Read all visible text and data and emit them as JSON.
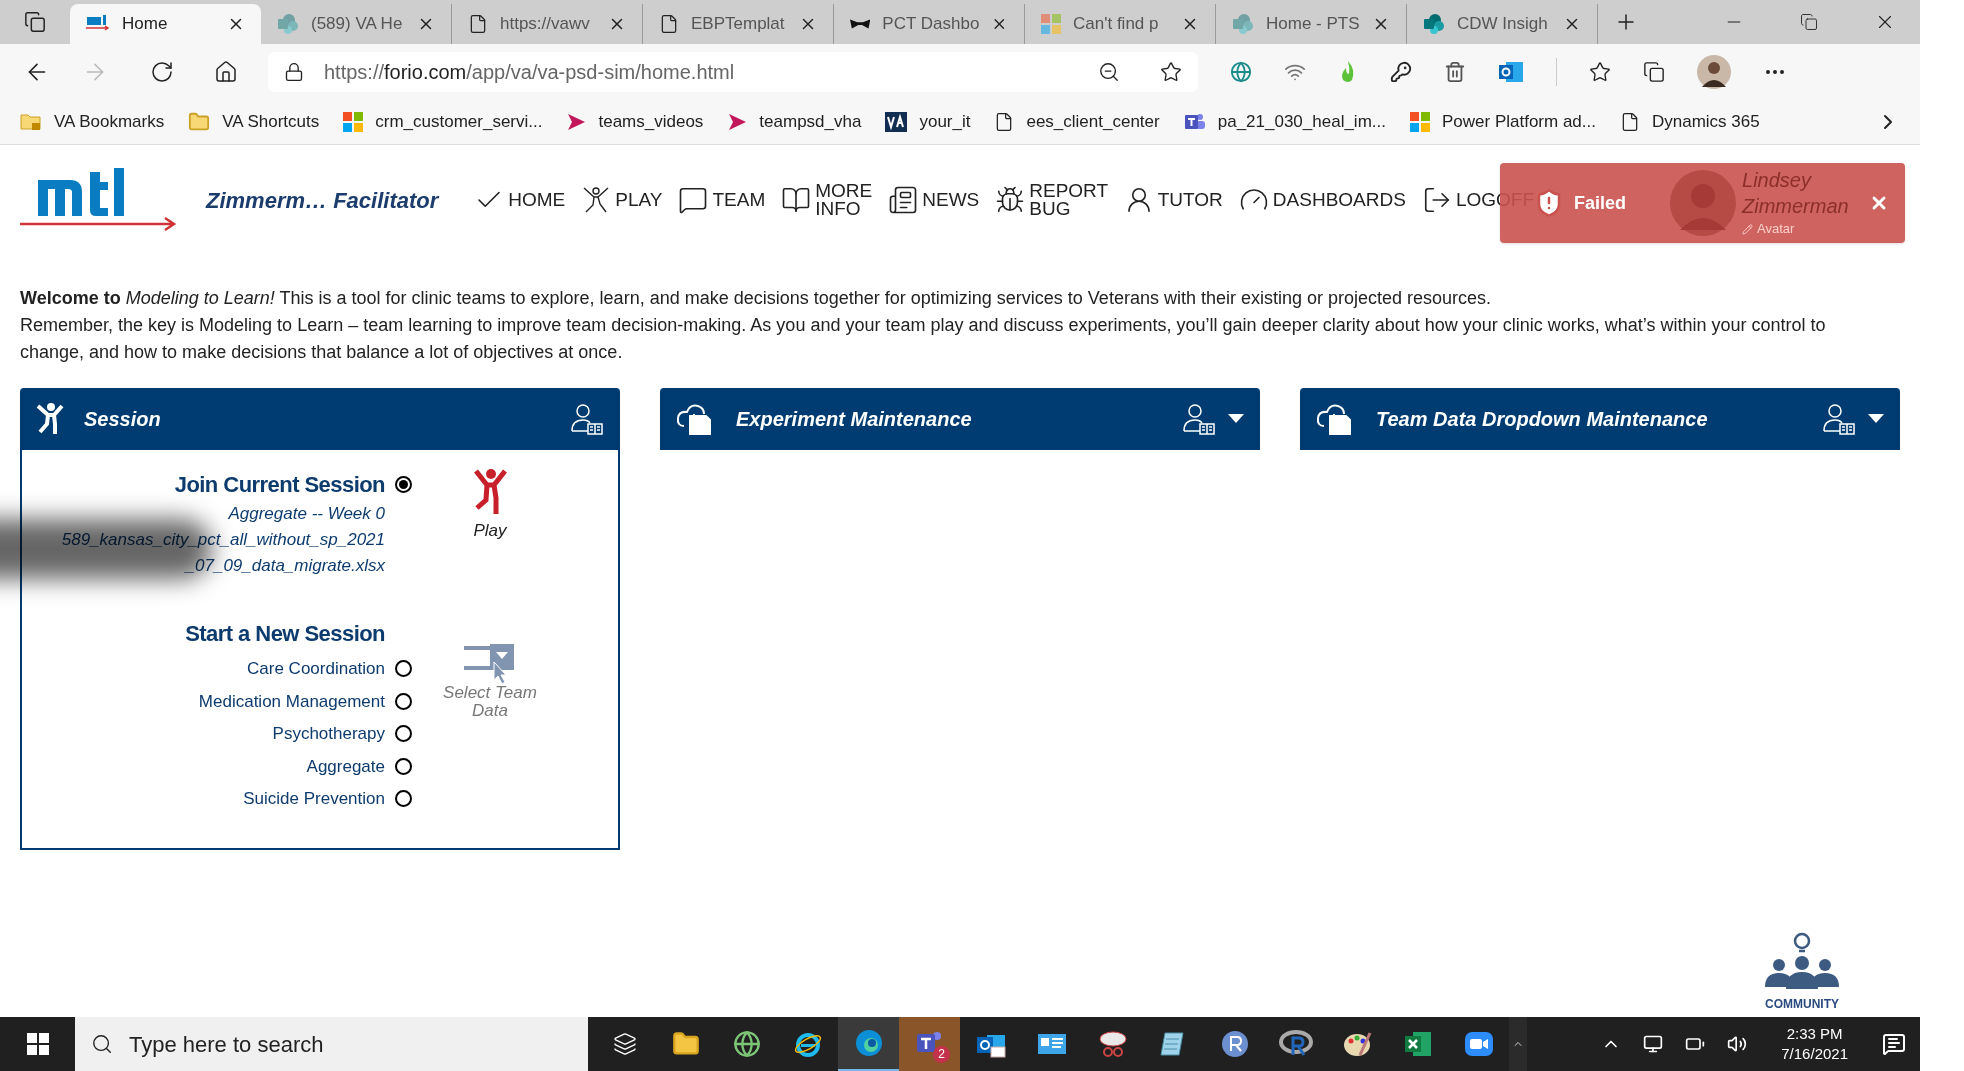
{
  "browser": {
    "tabs": [
      {
        "label": "Home",
        "kind": "mtl",
        "selected": true
      },
      {
        "label": "(589) VA He",
        "kind": "sharepoint-faded",
        "selected": false
      },
      {
        "label": "https://vawv",
        "kind": "page",
        "selected": false
      },
      {
        "label": "EBPTemplat",
        "kind": "page",
        "selected": false
      },
      {
        "label": "PCT Dashbo",
        "kind": "mask",
        "selected": false
      },
      {
        "label": "Can't find p",
        "kind": "windows-faded",
        "selected": false
      },
      {
        "label": "Home - PTS",
        "kind": "sharepoint-faded",
        "selected": false
      },
      {
        "label": "CDW Insigh",
        "kind": "sharepoint",
        "selected": false
      }
    ],
    "address": {
      "scheme": "https://",
      "host": "forio.com",
      "path": "/app/va/va-psd-sim/home.html"
    },
    "bookmarks": [
      {
        "label": "VA Bookmarks",
        "kind": "folder-lock"
      },
      {
        "label": "VA Shortcuts",
        "kind": "folder"
      },
      {
        "label": "crm_customer_servi...",
        "kind": "windows"
      },
      {
        "label": "teams_videos",
        "kind": "play"
      },
      {
        "label": "teampsd_vha",
        "kind": "play"
      },
      {
        "label": "your_it",
        "kind": "va"
      },
      {
        "label": "ees_client_center",
        "kind": "page"
      },
      {
        "label": "pa_21_030_heal_im...",
        "kind": "teams"
      },
      {
        "label": "Power Platform ad...",
        "kind": "windows"
      },
      {
        "label": "Dynamics 365",
        "kind": "page"
      }
    ]
  },
  "app": {
    "title": "Zimmerm… Facilitator",
    "nav": [
      {
        "label": "HOME",
        "kind": "check"
      },
      {
        "label": "PLAY",
        "kind": "play"
      },
      {
        "label": "TEAM",
        "kind": "chat"
      },
      {
        "label": "MORE INFO",
        "kind": "book"
      },
      {
        "label": "NEWS",
        "kind": "news"
      },
      {
        "label": "REPORT BUG",
        "kind": "bug"
      },
      {
        "label": "TUTOR",
        "kind": "tutor"
      },
      {
        "label": "DASHBOARDS",
        "kind": "gauge"
      },
      {
        "label": "LOGOFF",
        "kind": "logoff"
      }
    ],
    "toast": {
      "status": "Failed",
      "user": "Lindsey Zimmerman",
      "avatar_link": "Avatar"
    },
    "welcome": [
      "**Welcome to** *Modeling to Learn!* This is a tool for clinic teams to explore, learn, and make decisions together for optimizing services to Veterans with their existing or projected resources.",
      "Remember, the key is Modeling to Learn – team learning to improve team decision-making. As you and your team play and discuss experiments, you’ll gain deeper clarity about how your clinic works, what’s within your control to change, and how to make decisions that balance a lot of objectives at once."
    ],
    "panels": [
      {
        "title": "Session",
        "kind": "session",
        "dropdown": false
      },
      {
        "title": "Experiment Maintenance",
        "kind": "maintenance",
        "dropdown": true
      },
      {
        "title": "Team Data Dropdown Maintenance",
        "kind": "maintenance",
        "dropdown": true
      }
    ],
    "session": {
      "join": {
        "heading": "Join Current Session",
        "selected": true,
        "lines": [
          "Aggregate -- Week 0",
          "589_kansas_city_pct_all_without_sp_2021",
          "_07_09_data_migrate.xlsx"
        ]
      },
      "play_label": "Play",
      "new": {
        "heading": "Start a New Session",
        "options": [
          {
            "label": "Care Coordination",
            "selected": false
          },
          {
            "label": "Medication Management",
            "selected": false
          },
          {
            "label": "Psychotherapy",
            "selected": false
          },
          {
            "label": "Aggregate",
            "selected": false
          },
          {
            "label": "Suicide Prevention",
            "selected": false
          }
        ]
      },
      "select_label": "Select Team Data"
    },
    "community": "COMMUNITY"
  },
  "taskbar": {
    "search_placeholder": "Type here to search",
    "apps": [
      {
        "kind": "taskview"
      },
      {
        "kind": "explorer"
      },
      {
        "kind": "globe"
      },
      {
        "kind": "ie"
      },
      {
        "kind": "edge",
        "selected": true
      },
      {
        "kind": "teams",
        "badge": "2",
        "selected": false
      },
      {
        "kind": "outlook"
      },
      {
        "kind": "card"
      },
      {
        "kind": "snip"
      },
      {
        "kind": "note"
      },
      {
        "kind": "r"
      },
      {
        "kind": "rstudio"
      },
      {
        "kind": "paint"
      },
      {
        "kind": "excel"
      },
      {
        "kind": "zoom"
      }
    ],
    "time": "2:33 PM",
    "date": "7/16/2021"
  }
}
